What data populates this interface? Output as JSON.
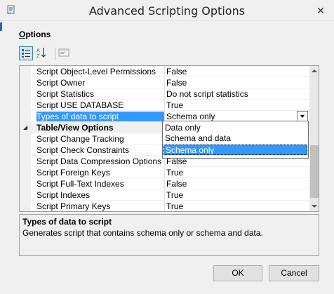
{
  "window": {
    "title": "Advanced Scripting Options",
    "close_glyph": "✕",
    "icon": "app-scroll-icon"
  },
  "section": {
    "label": "Options",
    "mnemonic": "O",
    "label_rest": "ptions"
  },
  "toolbar": {
    "items": [
      {
        "name": "categorized-icon",
        "active": true
      },
      {
        "name": "alphabetical-icon",
        "active": false
      },
      {
        "name": "property-pages-icon",
        "active": false
      }
    ]
  },
  "properties": {
    "rows": [
      {
        "type": "prop",
        "name": "Script Object-Level Permissions",
        "value": "False"
      },
      {
        "type": "prop",
        "name": "Script Owner",
        "value": "False"
      },
      {
        "type": "prop",
        "name": "Script Statistics",
        "value": "Do not script statistics"
      },
      {
        "type": "prop",
        "name": "Script USE DATABASE",
        "value": "True"
      },
      {
        "type": "prop",
        "name": "Types of data to script",
        "value": "Schema only",
        "selected": true
      },
      {
        "type": "cat",
        "name": "Table/View Options",
        "value": ""
      },
      {
        "type": "prop",
        "name": "Script Change Tracking",
        "value": ""
      },
      {
        "type": "prop",
        "name": "Script Check Constraints",
        "value": ""
      },
      {
        "type": "prop",
        "name": "Script Data Compression Options",
        "value": "False"
      },
      {
        "type": "prop",
        "name": "Script Foreign Keys",
        "value": "True"
      },
      {
        "type": "prop",
        "name": "Script Full-Text Indexes",
        "value": "False"
      },
      {
        "type": "prop",
        "name": "Script Indexes",
        "value": "True"
      },
      {
        "type": "prop",
        "name": "Script Primary Keys",
        "value": "True"
      }
    ],
    "collapse_glyph": "◢"
  },
  "dropdown": {
    "options": [
      "Data only",
      "Schema and data",
      "Schema only"
    ],
    "selected_index": 2
  },
  "description": {
    "title": "Types of data to script",
    "text": "Generates script that contains schema only or schema and data."
  },
  "buttons": {
    "ok": "OK",
    "cancel": "Cancel"
  },
  "colors": {
    "selection": "#3399ff",
    "accent": "#2c62c6"
  }
}
